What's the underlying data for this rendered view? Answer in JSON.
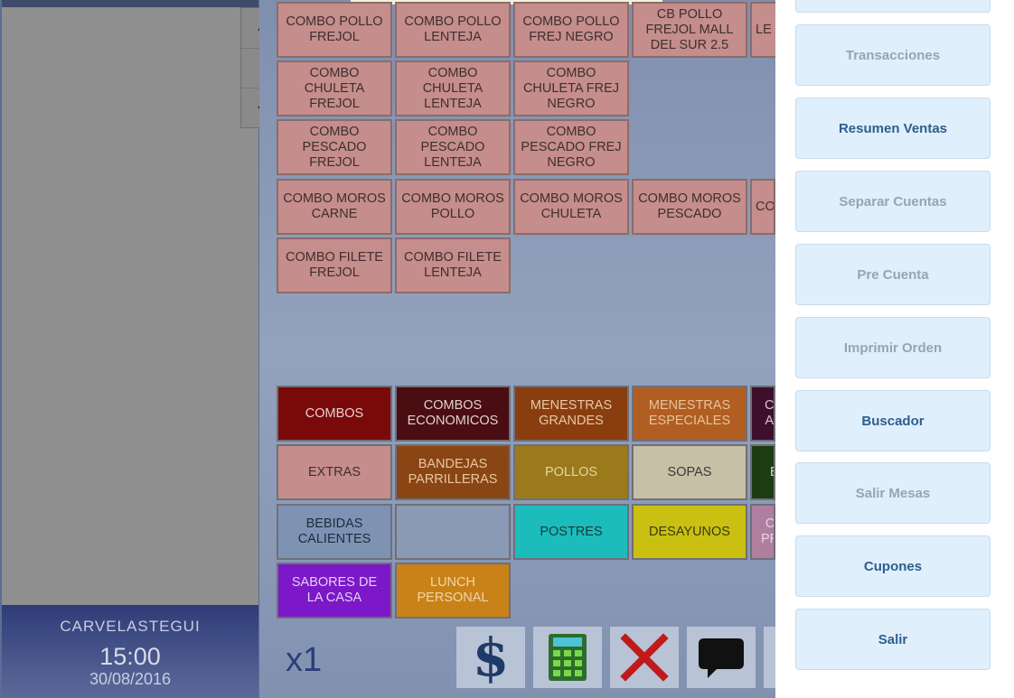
{
  "order_panel": {
    "user": "CARVELASTEGUI",
    "time": "15:00",
    "date": "30/08/2016",
    "scroll_up": "▲",
    "scroll_down": "▼"
  },
  "products": [
    {
      "label": "COMBO POLLO FREJOL"
    },
    {
      "label": "COMBO POLLO LENTEJA"
    },
    {
      "label": "COMBO POLLO FREJ NEGRO"
    },
    {
      "label": "CB POLLO FREJOL MALL DEL SUR 2.5"
    },
    {
      "label": "LE D"
    },
    {
      "label": "COMBO CHULETA FREJOL"
    },
    {
      "label": "COMBO CHULETA LENTEJA"
    },
    {
      "label": "COMBO CHULETA FREJ NEGRO"
    },
    {
      "label": "COMBO PESCADO FREJOL"
    },
    {
      "label": "COMBO PESCADO LENTEJA"
    },
    {
      "label": "COMBO PESCADO FREJ NEGRO"
    },
    {
      "label": "COMBO MOROS CARNE"
    },
    {
      "label": "COMBO MOROS POLLO"
    },
    {
      "label": "COMBO MOROS CHULETA"
    },
    {
      "label": "COMBO MOROS PESCADO"
    },
    {
      "label": "CO"
    },
    {
      "label": "COMBO FILETE FREJOL"
    },
    {
      "label": "COMBO FILETE LENTEJA"
    }
  ],
  "categories": [
    {
      "label": "COMBOS",
      "bg": "#7a0a0a",
      "fg": "#e6d0d0"
    },
    {
      "label": "COMBOS ECONOMICOS",
      "bg": "#4a0d12",
      "fg": "#e2d0d0"
    },
    {
      "label": "MENESTRAS GRANDES",
      "bg": "#8a3e10",
      "fg": "#e8c7a8"
    },
    {
      "label": "MENESTRAS ESPECIALES",
      "bg": "#b05e22",
      "fg": "#e9c39a"
    },
    {
      "label": "C A",
      "bg": "#3e0f2c",
      "fg": "#d8c6d0"
    },
    {
      "label": "EXTRAS",
      "bg": "#c58d8b",
      "fg": "#3e2f2f"
    },
    {
      "label": "BANDEJAS PARRILLERAS",
      "bg": "#8a4515",
      "fg": "#e8c79e"
    },
    {
      "label": "POLLOS",
      "bg": "#9b7a1c",
      "fg": "#e5d5a0"
    },
    {
      "label": "SOPAS",
      "bg": "#c7bfa6",
      "fg": "#3a3a3a"
    },
    {
      "label": "E",
      "bg": "#1e3c12",
      "fg": "#cfdcc4"
    },
    {
      "label": "BEBIDAS CALIENTES",
      "bg": "#7e93b3",
      "fg": "#1e2a3e"
    },
    {
      "label": "",
      "bg": "#8a9ab5",
      "fg": "#333333"
    },
    {
      "label": "POSTRES",
      "bg": "#1cbcbc",
      "fg": "#1a3a3a"
    },
    {
      "label": "DESAYUNOS",
      "bg": "#c9c012",
      "fg": "#3a3a10"
    },
    {
      "label": "C PR",
      "bg": "#b07fa0",
      "fg": "#e8d6e2"
    },
    {
      "label": "SABORES DE LA CASA",
      "bg": "#7c18c8",
      "fg": "#e2d0f2"
    },
    {
      "label": "LUNCH PERSONAL",
      "bg": "#c98218",
      "fg": "#f0d6a8"
    }
  ],
  "toolbar": {
    "qty": "x1",
    "cash_icon": "dollar-icon",
    "calc_icon": "calculator-icon",
    "cancel_icon": "x-icon",
    "comment_icon": "speech-bubble-icon"
  },
  "side_menu": [
    {
      "label": "",
      "state": "active"
    },
    {
      "label": "Transacciones",
      "state": "disabled"
    },
    {
      "label": "Resumen Ventas",
      "state": "active"
    },
    {
      "label": "Separar Cuentas",
      "state": "disabled"
    },
    {
      "label": "Pre Cuenta",
      "state": "disabled"
    },
    {
      "label": "Imprimir Orden",
      "state": "disabled"
    },
    {
      "label": "Buscador",
      "state": "active"
    },
    {
      "label": "Salir Mesas",
      "state": "disabled"
    },
    {
      "label": "Cupones",
      "state": "active"
    },
    {
      "label": "Salir",
      "state": "active"
    }
  ],
  "colors": {
    "product_tile": "#c58d8b",
    "side_active_text": "#2d5f8e",
    "side_disabled_text": "#9aa4ad",
    "side_button_bg": "#e0effc"
  }
}
